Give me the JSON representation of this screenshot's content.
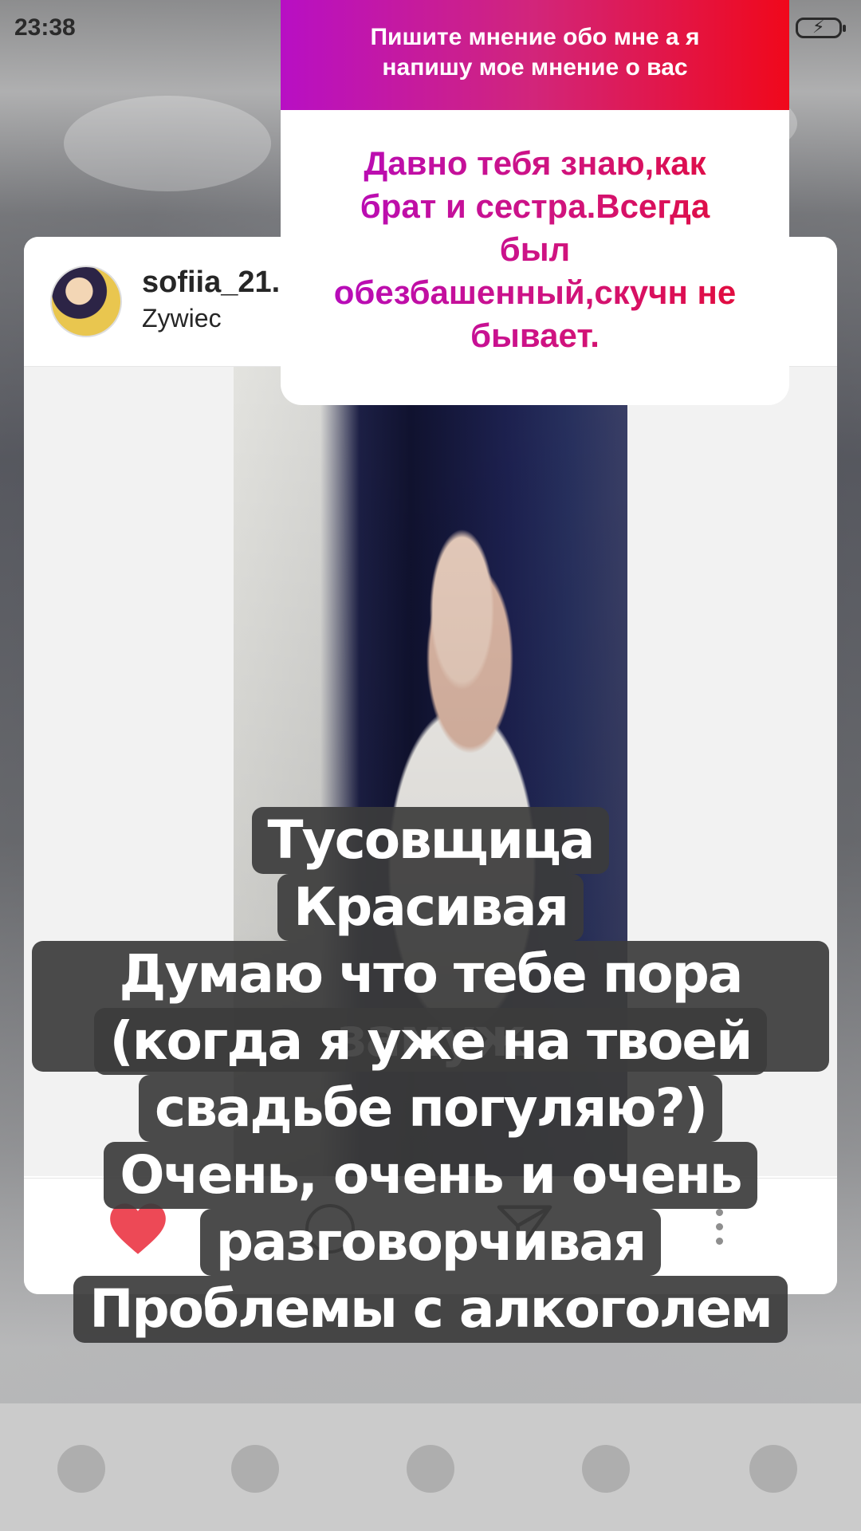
{
  "status_bar": {
    "time": "23:38"
  },
  "question_sticker": {
    "prompt_line1": "Пишите мнение обо мне а я",
    "prompt_line2": "напишу мое мнение о вас",
    "answer_lines": [
      "Давно тебя знаю,как",
      "брат и сестра.Всегда",
      "был",
      "обезбашенный,скучн не",
      "бывает."
    ]
  },
  "post": {
    "username": "sofiia_21.",
    "location": "Zywiec"
  },
  "caption_lines": [
    "Тусовщица",
    "Красивая",
    "Думаю что тебе пора замуж",
    "(когда я уже на твоей",
    "свадьбе погуляю?)",
    "Очень, очень и очень",
    "разговорчивая",
    "Проблемы с алкоголем"
  ],
  "colors": {
    "sticker_gradient_start": "#b80fc4",
    "sticker_gradient_end": "#f0081b",
    "like_heart": "#ed4956"
  },
  "icons": {
    "like": "heart-icon",
    "comment": "comment-icon",
    "share": "paper-plane-icon",
    "more": "more-vertical-icon",
    "battery": "battery-charging-icon"
  }
}
